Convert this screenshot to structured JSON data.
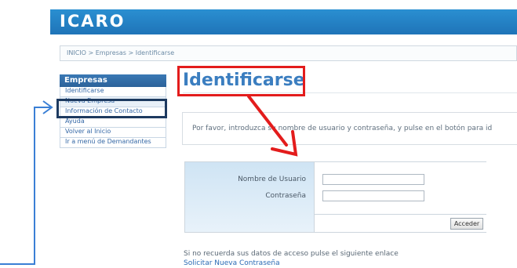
{
  "header": {
    "logo": "ICARO"
  },
  "breadcrumb": "INICIO > Empresas > Identificarse",
  "sidebar": {
    "title": "Empresas",
    "items": [
      {
        "label": "Identificarse"
      },
      {
        "label": "Nueva Empresa"
      },
      {
        "label": "Información de Contacto"
      },
      {
        "label": "Ayuda"
      },
      {
        "label": "Volver al Inicio"
      },
      {
        "label": "Ir a menú de Demandantes"
      }
    ]
  },
  "main": {
    "title": "Identificarse",
    "instructions": "Por favor, introduzca su nombre de usuario y contraseña, y pulse en el botón para id",
    "form": {
      "username_label": "Nombre de Usuario",
      "password_label": "Contraseña",
      "submit_label": "Acceder"
    },
    "recover_text": "Si no recuerda sus datos de acceso pulse el siguiente enlace",
    "recover_link": "Solicitar Nueva Contraseña"
  },
  "annotations": {
    "highlight_color": "#e31c1c",
    "arrow_color": "#3a7fd5",
    "box_color": "#1d3a60"
  }
}
